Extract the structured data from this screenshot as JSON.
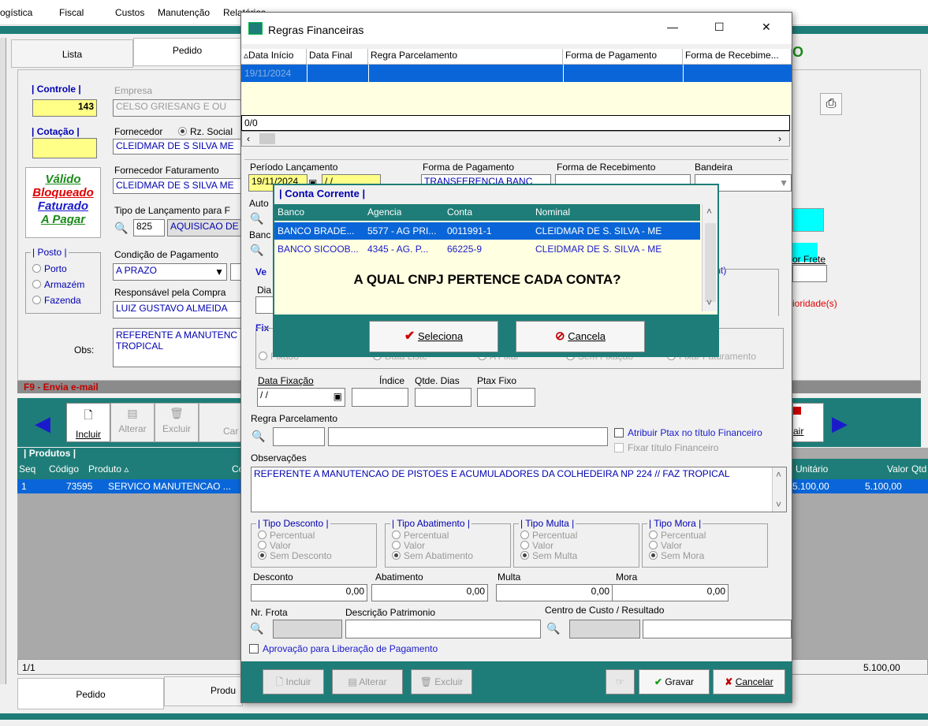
{
  "menu": [
    "ogística",
    "Fiscal",
    "Custos",
    "Manutenção",
    "Relatórios"
  ],
  "bg": {
    "tabs_top": [
      "Lista",
      "Pedido"
    ],
    "controle_label": "Controle",
    "controle_value": "143",
    "empresa_label": "Empresa",
    "empresa_value": "CELSO GRIESANG E OU",
    "cotacao_label": "Cotação",
    "fornecedor_label": "Fornecedor",
    "rz_social": "Rz. Social",
    "fornecedor_value": "CLEIDMAR DE S SILVA  ME",
    "forn_fat_label": "Fornecedor Faturamento",
    "forn_fat_value": "CLEIDMAR DE S SILVA  ME",
    "status": [
      "Válido",
      "Bloqueado",
      "Faturado",
      "A Pagar"
    ],
    "tipo_lanc_label": "Tipo de Lançamento para F",
    "tipo_lanc_code": "825",
    "tipo_lanc_desc": "AQUISICAO DE",
    "posto_label": "Posto",
    "posto_opts": [
      "Porto",
      "Armazém",
      "Fazenda"
    ],
    "cond_pag_label": "Condição de Pagamento",
    "cond_pag_value": "A PRAZO",
    "resp_label": "Responsável pela Compra",
    "resp_value": "LUIZ GUSTAVO ALMEIDA",
    "obs_label": "Obs:",
    "obs_value": "REFERENTE A MANUTENC TROPICAL",
    "f9": "F9 - Envia e-mail",
    "toolbar": [
      "Incluir",
      "Alterar",
      "Excluir",
      "Car"
    ],
    "sair": "air",
    "produtos_label": "Produtos",
    "prod_headers": [
      "Seq",
      "Código",
      "Produto",
      "Co"
    ],
    "prod_row": {
      "seq": "1",
      "codigo": "73595",
      "produto": "SERVICO MANUTENCAO ..."
    },
    "right_headers": [
      "Unitário",
      "Valor",
      "Qtd"
    ],
    "right_row": [
      "5.100,00",
      "5.100,00"
    ],
    "count": "1/1",
    "total": "5.100,00",
    "tabs_bottom": [
      "Pedido",
      "Produ"
    ],
    "frete": "or Frete",
    "prioridade": "ioridade(s)",
    "int_label": "Int)"
  },
  "dialog": {
    "title": "Regras Financeiras",
    "grid_headers": [
      "Data Início",
      "Data Final",
      "Regra Parcelamento",
      "Forma de Pagamento",
      "Forma de Recebime..."
    ],
    "grid_row_date": "19/11/2024",
    "grid_count": "0/0",
    "periodo_label": "Período Lançamento",
    "periodo_value": "19/11/2024",
    "periodo_end": "/ /",
    "forma_pag_label": "Forma de Pagamento",
    "forma_pag_value": "TRANSFERENCIA BANC",
    "forma_rec_label": "Forma de Recebimento",
    "bandeira_label": "Bandeira",
    "auto_label": "Auto",
    "banc_label": "Banc",
    "ve_label": "Ve",
    "dia_label": "Dia",
    "fix_label": "Fix",
    "fix_opts": [
      "Fixado",
      "Data Liste",
      "A Fixar",
      "Sem Fixação",
      "Fixar Faturamento"
    ],
    "data_fix_label": "Data Fixação",
    "data_fix_value": "/ /",
    "indice_label": "Índice",
    "qtde_dias_label": "Qtde. Dias",
    "ptax_label": "Ptax Fixo",
    "regra_label": "Regra Parcelamento",
    "atribuir_ptax": "Atribuir Ptax no título Financeiro",
    "fixar_titulo": "Fixar título Financeiro",
    "obs_label": "Observações",
    "obs_value": "REFERENTE A MANUTENCAO DE PISTOES E ACUMULADORES DA COLHEDEIRA NP 224 // FAZ TROPICAL",
    "tipo_desconto": {
      "title": "Tipo Desconto",
      "opts": [
        "Percentual",
        "Valor",
        "Sem Desconto"
      ]
    },
    "tipo_abatimento": {
      "title": "Tipo Abatimento",
      "opts": [
        "Percentual",
        "Valor",
        "Sem Abatimento"
      ]
    },
    "tipo_multa": {
      "title": "Tipo Multa",
      "opts": [
        "Percentual",
        "Valor",
        "Sem Multa"
      ]
    },
    "tipo_mora": {
      "title": "Tipo Mora",
      "opts": [
        "Percentual",
        "Valor",
        "Sem Mora"
      ]
    },
    "desconto_label": "Desconto",
    "abatimento_label": "Abatimento",
    "multa_label": "Multa",
    "mora_label": "Mora",
    "zero": "0,00",
    "nr_frota_label": "Nr. Frota",
    "desc_patr_label": "Descrição Patrimonio",
    "centro_label": "Centro de Custo / Resultado",
    "aprovacao_label": "Aprovação para Liberação de Pagamento",
    "btn_incluir": "Incluir",
    "btn_alterar": "Alterar",
    "btn_excluir": "Excluir",
    "btn_gravar": "Gravar",
    "btn_cancelar": "Cancelar"
  },
  "popup": {
    "title": "Conta Corrente",
    "headers": [
      "Banco",
      "Agencia",
      "Conta",
      "Nominal"
    ],
    "rows": [
      {
        "banco": "BANCO BRADE...",
        "agencia": "5577 - AG PRI...",
        "conta": "0011991-1",
        "nominal": "CLEIDMAR DE S. SILVA - ME"
      },
      {
        "banco": "BANCO SICOOB...",
        "agencia": "4345 - AG. P...",
        "conta": "66225-9",
        "nominal": "CLEIDMAR DE S. SILVA - ME"
      }
    ],
    "question": "A QUAL CNPJ PERTENCE CADA CONTA?",
    "btn_seleciona": "Seleciona",
    "btn_cancela": "Cancela"
  },
  "colors": {
    "teal": "#1e7d78",
    "selection": "#0a66d8",
    "yellow": "#ffff88",
    "cream": "#ffffe1"
  }
}
